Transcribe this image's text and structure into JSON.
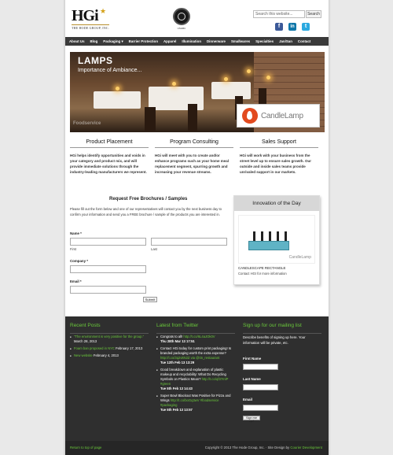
{
  "header": {
    "logo_text": "HGi",
    "logo_subtitle": "THE HODE GROUP, INC.",
    "seal_caption": "USGBC",
    "search_placeholder": "Search this website...",
    "search_button": "Search",
    "social": [
      {
        "icon": "facebook-icon",
        "glyph": "f",
        "color": "#3b5998"
      },
      {
        "icon": "linkedin-icon",
        "glyph": "in",
        "color": "#0e76a8"
      },
      {
        "icon": "twitter-icon",
        "glyph": "t",
        "color": "#2aa9e0"
      }
    ]
  },
  "nav": {
    "items": [
      "About Us",
      "Blog",
      "Packaging ▾",
      "Barrier Protection",
      "Apparel",
      "Illumination",
      "Dinnerware",
      "Smallwares",
      "Specialties",
      "Jan/San",
      "Contact"
    ]
  },
  "hero": {
    "title": "LAMPS",
    "subtitle": "Importance of Ambiance...",
    "caption": "Foodservice",
    "brand": "CandleLamp"
  },
  "columns": [
    {
      "title": "Product Placement",
      "text": "HGi helps identify opportunities and voids in your category and product mix, and will provide immediate solutions through the industry-leading manufacturers we represent."
    },
    {
      "title": "Program Consulting",
      "text": "HGi will meet with you to create and/or enhance programs such as your home meal replacement segment, spurring growth and increasing your revenue streams."
    },
    {
      "title": "Sales Support",
      "text": "HGi will work with your business from the street level up to ensure sales growth. Our outside and inside sales teams provide unrivaled support in our markets."
    }
  ],
  "form": {
    "title": "Request Free Brochures / Samples",
    "intro": "Please fill out the form below and one of our representatives will contact you by the next business day to confirm your information and send you a FREE brochure / sample of the products you are interested in.",
    "name_label": "Name *",
    "first_label": "First",
    "last_label": "Last",
    "company_label": "Company *",
    "email_label": "Email *",
    "submit": "Submit"
  },
  "innovation": {
    "title": "Innovation of the Day",
    "product_label": "CandleLamp",
    "product_name": "CANDLESCAPE RECTANGLE",
    "contact": "Contact HGI for more information"
  },
  "footer": {
    "recent_posts_title": "Recent Posts",
    "posts": [
      {
        "link": "\"The environment is very positive for the group.\"",
        "date": "March 28, 2013"
      },
      {
        "link": "Foam ban proposed in NYC",
        "date": "February 17, 2013"
      },
      {
        "link": "New website",
        "date": "February 4, 2013"
      }
    ],
    "twitter_title": "Latest from Twitter",
    "tweets": [
      {
        "text": "Congrats to all! ",
        "link": "http://t.co/6L4aJOk0V",
        "time": "Thu 28th Mar 13 17:51"
      },
      {
        "text": "Contact HGi today for custom print packaging! Is branded packaging worth the extra expense? ",
        "link": "http://t.co/3q2vkN2Z via @ttn_restaurant",
        "time": "Tue 12th Feb 13 13:29"
      },
      {
        "text": "Good breakdown and explanation of plastic makeup and recyclability: What Do Recycling Symbols on Plastics Mean? ",
        "link": "http://t.co/qf37mlP #green",
        "time": "Tue 5th Feb 13 14:43"
      },
      {
        "text": "Super Bowl Blackout Was Positive for Pizza and Wings ",
        "link": "http://t.co/boGq3wV #foodservice #packaging",
        "time": "Tue 5th Feb 13 13:57"
      }
    ],
    "mailing_title": "Sign up for our mailing list",
    "mailing_text": "Describe benefits of signing up here. Your information will be private, etc.",
    "first_name": "First Name",
    "last_name": "Last Name",
    "email": "Email",
    "signup": "Sign me up!",
    "back_top": "Return to top of page",
    "copyright": "Copyright © 2013 The Hode Group, Inc. · Site Design by ",
    "designer": "Courier Development"
  }
}
